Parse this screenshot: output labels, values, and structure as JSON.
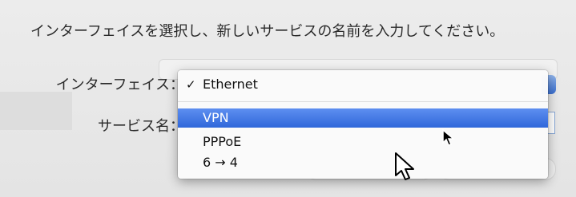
{
  "instruction": "インターフェイスを選択し、新しいサービスの名前を入力してください。",
  "form": {
    "interface_label": "インターフェイス：",
    "service_name_label": "サービス名："
  },
  "interface_menu": {
    "selected": "Ethernet",
    "check_mark": "✓",
    "items": [
      {
        "label": "Ethernet",
        "checked": true,
        "highlighted": false
      },
      {
        "label": "VPN",
        "checked": false,
        "highlighted": true
      },
      {
        "label": "PPPoE",
        "checked": false,
        "highlighted": false
      },
      {
        "label": "6 → 4",
        "checked": false,
        "highlighted": false
      }
    ]
  },
  "colors": {
    "highlight": "#3b74e0",
    "background": "#e9e9e9"
  }
}
